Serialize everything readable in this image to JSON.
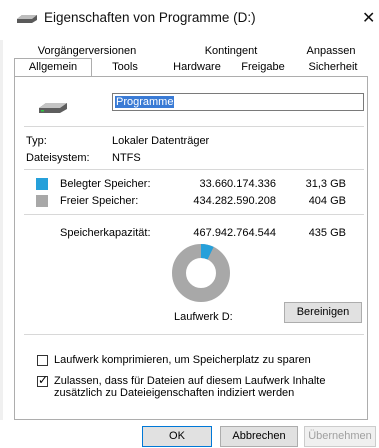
{
  "window": {
    "title": "Eigenschaften von Programme (D:)",
    "close_glyph": "✕"
  },
  "tabs": {
    "row_back": [
      "Vorgängerversionen",
      "Kontingent",
      "Anpassen"
    ],
    "row_front": [
      "Allgemein",
      "Tools",
      "Hardware",
      "Freigabe",
      "Sicherheit"
    ],
    "active": "Allgemein"
  },
  "general": {
    "drive_name": "Programme",
    "type_label": "Typ:",
    "type_value": "Lokaler Datenträger",
    "fs_label": "Dateisystem:",
    "fs_value": "NTFS",
    "used": {
      "label": "Belegter Speicher:",
      "bytes": "33.660.174.336",
      "size": "31,3 GB",
      "color": "#26a0da"
    },
    "free": {
      "label": "Freier Speicher:",
      "bytes": "434.282.590.208",
      "size": "404 GB",
      "color": "#a8a8a8"
    },
    "capacity": {
      "label": "Speicherkapazität:",
      "bytes": "467.942.764.544",
      "size": "435 GB"
    },
    "drive_label": "Laufwerk D:",
    "cleanup_button": "Bereinigen",
    "compress_checkbox": {
      "label": "Laufwerk komprimieren, um Speicherplatz zu sparen",
      "checked": false
    },
    "index_checkbox": {
      "label_line1": "Zulassen, dass für Dateien auf diesem Laufwerk Inhalte",
      "label_line2": "zusätzlich zu Dateieigenschaften indiziert werden",
      "checked": true
    }
  },
  "buttons": {
    "ok": "OK",
    "cancel": "Abbrechen",
    "apply": "Übernehmen"
  },
  "icons": {
    "title": "drive-icon",
    "drive": "drive-icon",
    "close": "close-icon"
  }
}
